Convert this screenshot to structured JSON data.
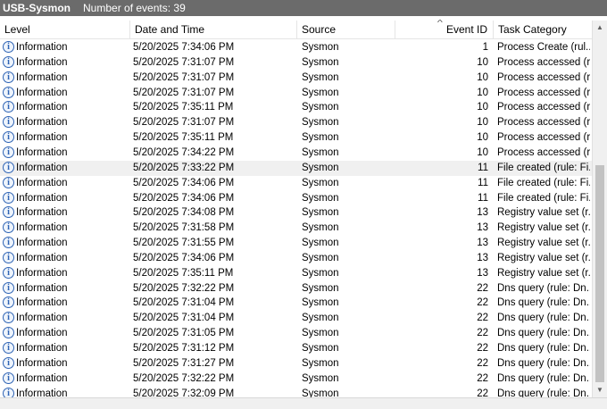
{
  "title": {
    "log_name": "USB-Sysmon",
    "event_count": "Number of events: 39"
  },
  "columns": {
    "level": "Level",
    "datetime": "Date and Time",
    "source": "Source",
    "event_id": "Event ID",
    "task": "Task Category"
  },
  "selected_row": 8,
  "rows": [
    {
      "level": "Information",
      "datetime": "5/20/2025 7:34:06 PM",
      "source": "Sysmon",
      "event_id": "1",
      "task": "Process Create (rul..."
    },
    {
      "level": "Information",
      "datetime": "5/20/2025 7:31:07 PM",
      "source": "Sysmon",
      "event_id": "10",
      "task": "Process accessed (r..."
    },
    {
      "level": "Information",
      "datetime": "5/20/2025 7:31:07 PM",
      "source": "Sysmon",
      "event_id": "10",
      "task": "Process accessed (r..."
    },
    {
      "level": "Information",
      "datetime": "5/20/2025 7:31:07 PM",
      "source": "Sysmon",
      "event_id": "10",
      "task": "Process accessed (r..."
    },
    {
      "level": "Information",
      "datetime": "5/20/2025 7:35:11 PM",
      "source": "Sysmon",
      "event_id": "10",
      "task": "Process accessed (r..."
    },
    {
      "level": "Information",
      "datetime": "5/20/2025 7:31:07 PM",
      "source": "Sysmon",
      "event_id": "10",
      "task": "Process accessed (r..."
    },
    {
      "level": "Information",
      "datetime": "5/20/2025 7:35:11 PM",
      "source": "Sysmon",
      "event_id": "10",
      "task": "Process accessed (r..."
    },
    {
      "level": "Information",
      "datetime": "5/20/2025 7:34:22 PM",
      "source": "Sysmon",
      "event_id": "10",
      "task": "Process accessed (r..."
    },
    {
      "level": "Information",
      "datetime": "5/20/2025 7:33:22 PM",
      "source": "Sysmon",
      "event_id": "11",
      "task": "File created (rule: Fi..."
    },
    {
      "level": "Information",
      "datetime": "5/20/2025 7:34:06 PM",
      "source": "Sysmon",
      "event_id": "11",
      "task": "File created (rule: Fi..."
    },
    {
      "level": "Information",
      "datetime": "5/20/2025 7:34:06 PM",
      "source": "Sysmon",
      "event_id": "11",
      "task": "File created (rule: Fi..."
    },
    {
      "level": "Information",
      "datetime": "5/20/2025 7:34:08 PM",
      "source": "Sysmon",
      "event_id": "13",
      "task": "Registry value set (r..."
    },
    {
      "level": "Information",
      "datetime": "5/20/2025 7:31:58 PM",
      "source": "Sysmon",
      "event_id": "13",
      "task": "Registry value set (r..."
    },
    {
      "level": "Information",
      "datetime": "5/20/2025 7:31:55 PM",
      "source": "Sysmon",
      "event_id": "13",
      "task": "Registry value set (r..."
    },
    {
      "level": "Information",
      "datetime": "5/20/2025 7:34:06 PM",
      "source": "Sysmon",
      "event_id": "13",
      "task": "Registry value set (r..."
    },
    {
      "level": "Information",
      "datetime": "5/20/2025 7:35:11 PM",
      "source": "Sysmon",
      "event_id": "13",
      "task": "Registry value set (r..."
    },
    {
      "level": "Information",
      "datetime": "5/20/2025 7:32:22 PM",
      "source": "Sysmon",
      "event_id": "22",
      "task": "Dns query (rule: Dn..."
    },
    {
      "level": "Information",
      "datetime": "5/20/2025 7:31:04 PM",
      "source": "Sysmon",
      "event_id": "22",
      "task": "Dns query (rule: Dn..."
    },
    {
      "level": "Information",
      "datetime": "5/20/2025 7:31:04 PM",
      "source": "Sysmon",
      "event_id": "22",
      "task": "Dns query (rule: Dn..."
    },
    {
      "level": "Information",
      "datetime": "5/20/2025 7:31:05 PM",
      "source": "Sysmon",
      "event_id": "22",
      "task": "Dns query (rule: Dn..."
    },
    {
      "level": "Information",
      "datetime": "5/20/2025 7:31:12 PM",
      "source": "Sysmon",
      "event_id": "22",
      "task": "Dns query (rule: Dn..."
    },
    {
      "level": "Information",
      "datetime": "5/20/2025 7:31:27 PM",
      "source": "Sysmon",
      "event_id": "22",
      "task": "Dns query (rule: Dn..."
    },
    {
      "level": "Information",
      "datetime": "5/20/2025 7:32:22 PM",
      "source": "Sysmon",
      "event_id": "22",
      "task": "Dns query (rule: Dn..."
    },
    {
      "level": "Information",
      "datetime": "5/20/2025 7:32:09 PM",
      "source": "Sysmon",
      "event_id": "22",
      "task": "Dns query (rule: Dn..."
    }
  ],
  "icons": {
    "level": "information-icon",
    "sort": "sort-ascending-icon"
  },
  "colors": {
    "titlebar": "#6b6b6b",
    "info_icon": "#2e63b4",
    "selected_row": "#f0f0f0"
  }
}
